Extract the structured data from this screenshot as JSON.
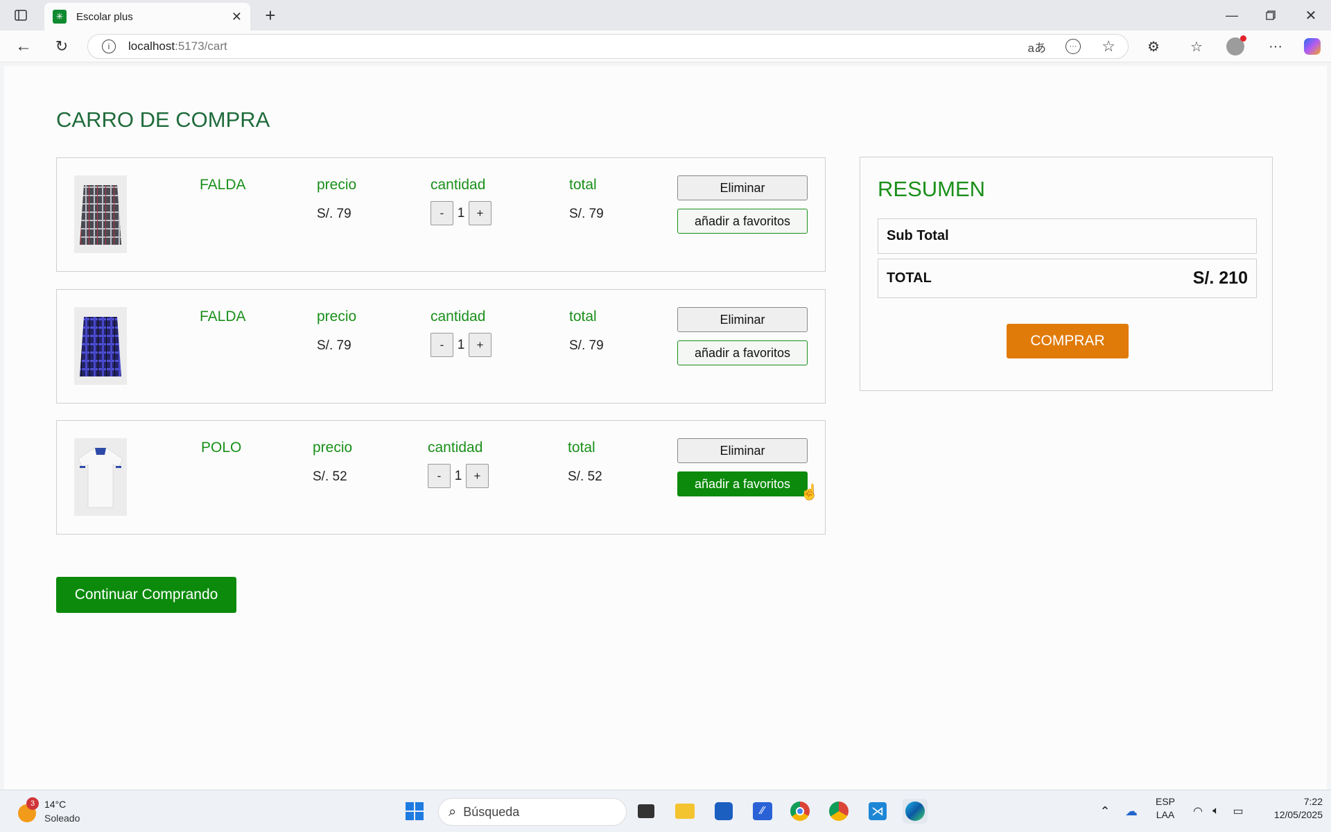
{
  "browser": {
    "tab_title": "Escolar plus",
    "url_host": "localhost",
    "url_path": ":5173/cart"
  },
  "page": {
    "title": "CARRO DE COMPRA",
    "headers": {
      "price": "precio",
      "quantity": "cantidad",
      "total": "total"
    },
    "items": [
      {
        "name": "FALDA",
        "price": "S/. 79",
        "quantity": "1",
        "total": "S/. 79",
        "image": "plaid-skirt-gray",
        "fav_active": false
      },
      {
        "name": "FALDA",
        "price": "S/. 79",
        "quantity": "1",
        "total": "S/. 79",
        "image": "plaid-skirt-blue",
        "fav_active": false
      },
      {
        "name": "POLO",
        "price": "S/. 52",
        "quantity": "1",
        "total": "S/. 52",
        "image": "white-polo",
        "fav_active": true
      }
    ],
    "buttons": {
      "remove": "Eliminar",
      "favorite": "añadir a favoritos",
      "minus": "-",
      "plus": "+",
      "continue": "Continuar Comprando"
    },
    "summary": {
      "title": "RESUMEN",
      "subtotal_label": "Sub Total",
      "total_label": "TOTAL",
      "total_value": "S/. 210",
      "buy": "COMPRAR"
    }
  },
  "taskbar": {
    "weather_temp": "14°C",
    "weather_desc": "Soleado",
    "weather_badge": "3",
    "search_placeholder": "Búsqueda",
    "lang": "ESP",
    "lang2": "LAA",
    "time": "7:22",
    "date": "12/05/2025"
  },
  "colors": {
    "accent_green": "#0b8a0b",
    "title_green": "#1e6b3a",
    "buy_orange": "#e07b0a"
  }
}
